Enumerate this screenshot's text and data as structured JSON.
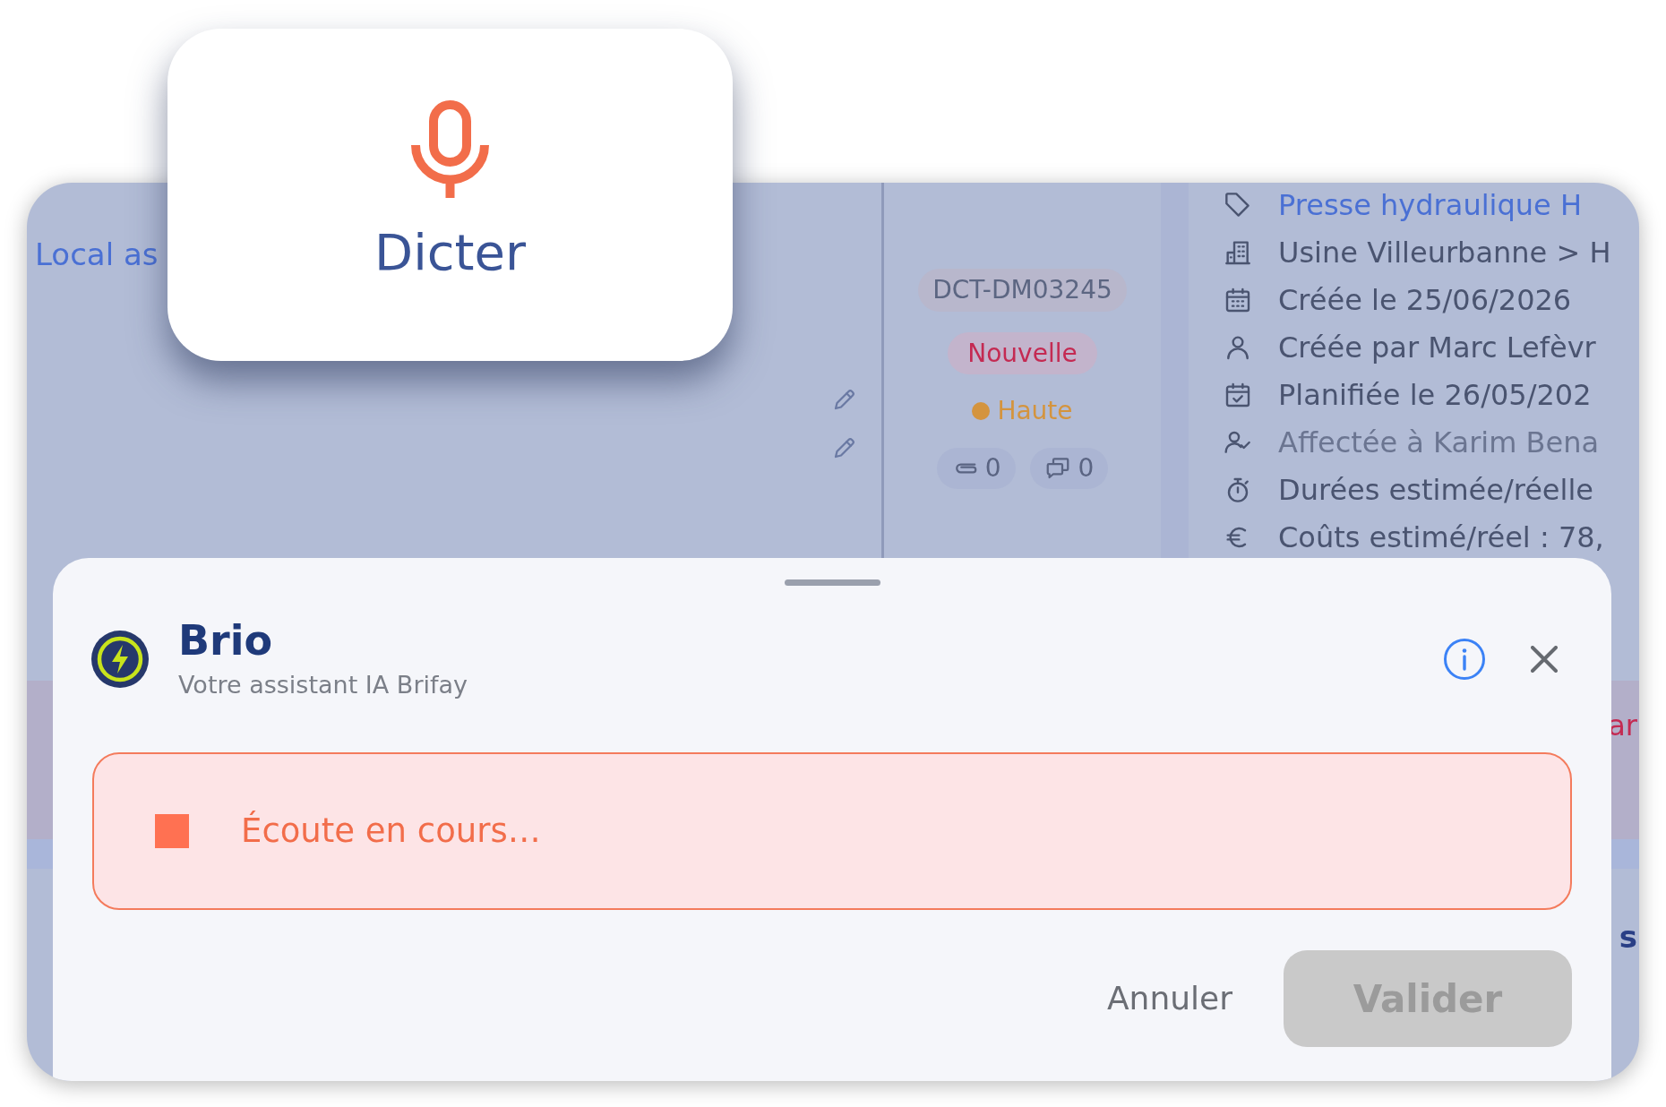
{
  "dictation_popup": {
    "label": "Dicter"
  },
  "background": {
    "left_panel": {
      "link": "Local as"
    },
    "summary": {
      "reference": "DCT-DM03245",
      "status": "Nouvelle",
      "priority": "Haute",
      "counters": [
        {
          "kind": "attachments",
          "count": "0"
        },
        {
          "kind": "comments",
          "count": "0"
        }
      ]
    },
    "details": [
      {
        "kind": "equipment",
        "text": "Presse hydraulique H"
      },
      {
        "kind": "location",
        "text": "Usine Villeurbanne > H"
      },
      {
        "kind": "created_on",
        "text": "Créée le 25/06/2026"
      },
      {
        "kind": "created_by",
        "text": "Créée par Marc Lefèvr"
      },
      {
        "kind": "planned_on",
        "text": "Planifiée le 26/05/202"
      },
      {
        "kind": "assigned_to",
        "text": "Affectée à Karim Bena"
      },
      {
        "kind": "durations",
        "text": "Durées estimée/réelle"
      },
      {
        "kind": "costs",
        "text": "Coûts estimé/réel : 78,"
      }
    ],
    "row_fragment": "ar",
    "heading_fragment": "s"
  },
  "assistant": {
    "title": "Brio",
    "subtitle": "Votre assistant IA Brifay",
    "listening": {
      "text": "Écoute en cours…"
    },
    "buttons": [
      {
        "kind": "text",
        "label": "Annuler",
        "disabled": false
      },
      {
        "kind": "filled",
        "label": "Valider",
        "disabled": true
      }
    ]
  }
}
